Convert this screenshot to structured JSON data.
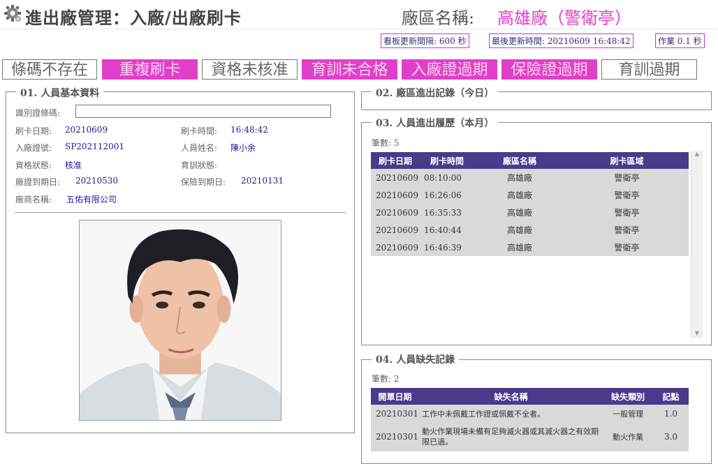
{
  "header": {
    "title": "進出廠管理：入廠/出廠刷卡",
    "plant_label": "廠區名稱:",
    "plant_value": "高雄廠（警衛亭）"
  },
  "info": {
    "refresh_interval": "看板更新間隔: 600 秒",
    "last_update": "最後更新時間: 20210609 16:48:42",
    "job": "作業 0.1 秒"
  },
  "status_buttons": [
    {
      "label": "條碼不存在",
      "active": false
    },
    {
      "label": "重複刷卡",
      "active": true
    },
    {
      "label": "資格未核准",
      "active": false
    },
    {
      "label": "育訓未合格",
      "active": true
    },
    {
      "label": "入廠證過期",
      "active": true
    },
    {
      "label": "保險證過期",
      "active": true
    },
    {
      "label": "育訓過期",
      "active": false
    }
  ],
  "panel1": {
    "legend": "01. 人員基本資料",
    "barcode_label": "識別證條碼:",
    "barcode_value": "",
    "swipe_date_label": "刷卡日期:",
    "swipe_date": "20210609",
    "swipe_time_label": "刷卡時間:",
    "swipe_time": "16:48:42",
    "pass_no_label": "入廠證號:",
    "pass_no": "SP202112001",
    "name_label": "人員姓名:",
    "name": "陳小余",
    "qual_label": "資格狀態:",
    "qual": "核准",
    "training_label": "育訓狀態:",
    "training": "",
    "pass_exp_label": "廠證到期日:",
    "pass_exp": "20210530",
    "ins_exp_label": "保險到期日:",
    "ins_exp": "20210131",
    "vendor_label": "廠商名稱:",
    "vendor": "五佑有限公司"
  },
  "panel2": {
    "legend": "02. 廠區進出記錄（今日）"
  },
  "panel3": {
    "legend": "03. 人員進出履歷（本月）",
    "count": "筆數: 5",
    "headers": [
      "刷卡日期",
      "刷卡時間",
      "廠區名稱",
      "刷卡區域"
    ],
    "rows": [
      [
        "20210609",
        "08:10:00",
        "高雄廠",
        "警衛亭"
      ],
      [
        "20210609",
        "16:26:06",
        "高雄廠",
        "警衛亭"
      ],
      [
        "20210609",
        "16:35:33",
        "高雄廠",
        "警衛亭"
      ],
      [
        "20210609",
        "16:40:44",
        "高雄廠",
        "警衛亭"
      ],
      [
        "20210609",
        "16:46:39",
        "高雄廠",
        "警衛亭"
      ]
    ]
  },
  "panel4": {
    "legend": "04. 人員缺失記錄",
    "count": "筆數: 2",
    "headers": [
      "開單日期",
      "缺失名稱",
      "缺失類別",
      "記點"
    ],
    "rows": [
      [
        "20210301",
        "工作中未佩戴工作證或佩戴不全者。",
        "一般管理",
        "1.0"
      ],
      [
        "20210301",
        "動火作業現場未備有足夠滅火器或其滅火器之有效期限已過。",
        "動火作業",
        "3.0"
      ]
    ]
  },
  "colors": {
    "accent": "#e040c8",
    "header_bg": "#4a3a8a",
    "row_bg": "#d9d9d9",
    "value": "#1a1aa0"
  },
  "icons": {
    "app": "gear-icon",
    "photo": "person-photo"
  }
}
